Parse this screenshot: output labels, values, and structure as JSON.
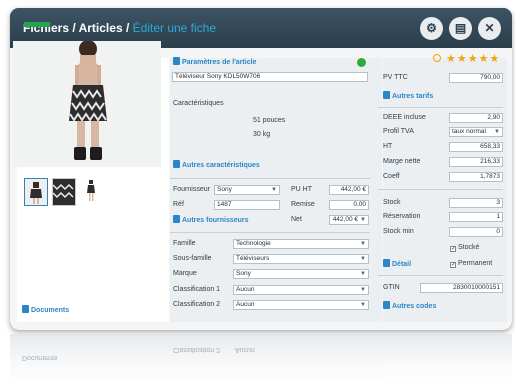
{
  "header": {
    "crumb_root": "Fichiers",
    "crumb_mid": "Articles",
    "crumb_current": "Éditer une fiche",
    "sep1": " / ",
    "sep2": " / "
  },
  "left": {
    "documents_link": "Documents"
  },
  "params": {
    "title": "Paramètres de l'article",
    "name": "Téléviseur Sony KDL50W706",
    "characteristics_label": "Caractéristiques",
    "char1": "51 pouces",
    "char2": "30 kg",
    "more_chars": "Autres caractéristiques"
  },
  "supplier": {
    "fournisseur_label": "Fournisseur",
    "fournisseur_value": "Sony",
    "ref_label": "Réf",
    "ref_value": "1487",
    "pu_ht_label": "PU HT",
    "pu_ht_value": "442,00 €",
    "remise_label": "Remise",
    "remise_value": "0,00",
    "net_label": "Net",
    "net_value": "442,00 €",
    "more_suppliers": "Autres fournisseurs"
  },
  "classification": {
    "famille_label": "Famille",
    "famille_value": "Technologie",
    "sous_famille_label": "Sous-famille",
    "sous_famille_value": "Téléviseurs",
    "marque_label": "Marque",
    "marque_value": "Sony",
    "class1_label": "Classification 1",
    "class1_value": "Aucun",
    "class2_label": "Classification 2",
    "class2_value": "Aucun"
  },
  "pricing": {
    "pv_ttc_label": "PV TTC",
    "pv_ttc_value": "790,00",
    "autres_tarifs": "Autres tarifs",
    "deee_label": "DEEE incluse",
    "deee_value": "2,90",
    "profil_label": "Profil TVA",
    "profil_value": "taux normal",
    "ht_label": "HT",
    "ht_value": "658,33",
    "marge_label": "Marge nette",
    "marge_value": "216,33",
    "coeff_label": "Coeff",
    "coeff_value": "1,7873"
  },
  "stock": {
    "stock_label": "Stock",
    "stock_value": "3",
    "reservation_label": "Réservation",
    "reservation_value": "1",
    "stock_min_label": "Stock min",
    "stock_min_value": "0",
    "stocke_label": "Stocké",
    "permanent_label": "Permanent",
    "detail_link": "Détail"
  },
  "codes": {
    "gtin_label": "GTIN",
    "gtin_value": "2830010000151",
    "autres_codes": "Autres codes"
  },
  "colors": {
    "title_bg": "#2b3e4c",
    "accent_blue": "#2a86c6",
    "status_green": "#2eaa3b",
    "star_orange": "#f5a40c"
  },
  "icons": [
    "settings-icon",
    "save-icon",
    "close-icon",
    "star-icon",
    "status-dot",
    "document-icon"
  ],
  "rating": 5
}
